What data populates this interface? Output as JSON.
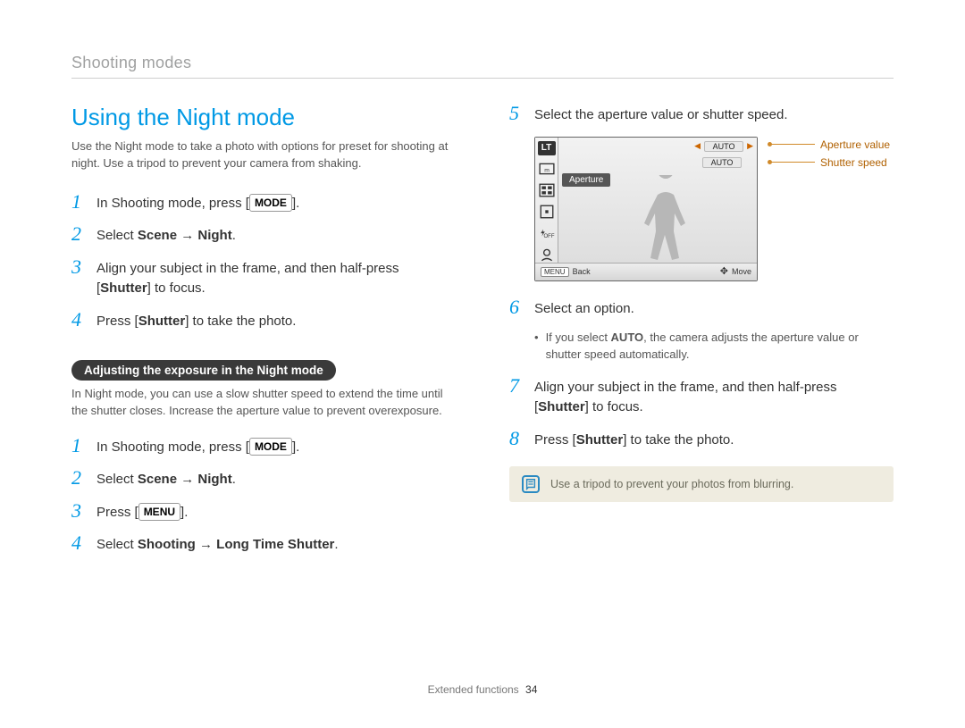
{
  "chapter": "Shooting modes",
  "heading": "Using the Night mode",
  "intro": "Use the Night mode to take a photo with options for preset for shooting at night. Use a tripod to prevent your camera from shaking.",
  "steps_a": [
    {
      "pre": "In Shooting mode, press [",
      "key": "MODE",
      "post": "]."
    },
    {
      "pre": "Select ",
      "bold": "Scene → Night",
      "post": "."
    },
    {
      "pre": "Align your subject in the frame, and then half-press [",
      "bold2": "Shutter",
      "post": "] to focus."
    },
    {
      "pre": "Press [",
      "bold2": "Shutter",
      "post": "] to take the photo."
    }
  ],
  "subheading": "Adjusting the exposure in the Night mode",
  "sub_body": "In Night mode, you can use a slow shutter speed to extend the time until the shutter closes. Increase the aperture value to prevent overexposure.",
  "steps_b": [
    {
      "pre": "In Shooting mode, press [",
      "key": "MODE",
      "post": "]."
    },
    {
      "pre": "Select ",
      "bold": "Scene → Night",
      "post": "."
    },
    {
      "pre": "Press [",
      "key": "MENU",
      "post": "]."
    },
    {
      "pre": "Select ",
      "bold": "Shooting → Long Time Shutter",
      "post": "."
    }
  ],
  "step5": "Select the aperture value or shutter speed.",
  "step6": "Select an option.",
  "step6_bullet_pre": "If you select ",
  "step6_bullet_bold": "AUTO",
  "step6_bullet_post": ", the camera adjusts the aperture value or shutter speed automatically.",
  "step7_pre": "Align your subject in the frame, and then half-press [",
  "step7_bold": "Shutter",
  "step7_post": "] to focus.",
  "step8_pre": "Press [",
  "step8_bold": "Shutter",
  "step8_post": "] to take the photo.",
  "tip": "Use a tripod to prevent your photos from blurring.",
  "footer_section": "Extended functions",
  "footer_page": "34",
  "screen": {
    "lt": "LT",
    "auto1": "AUTO",
    "auto2": "AUTO",
    "aperture_label": "Aperture",
    "back_label": "Back",
    "menu_label": "MENU",
    "move_label": "Move"
  },
  "callouts": {
    "aperture": "Aperture value",
    "shutter": "Shutter speed"
  }
}
